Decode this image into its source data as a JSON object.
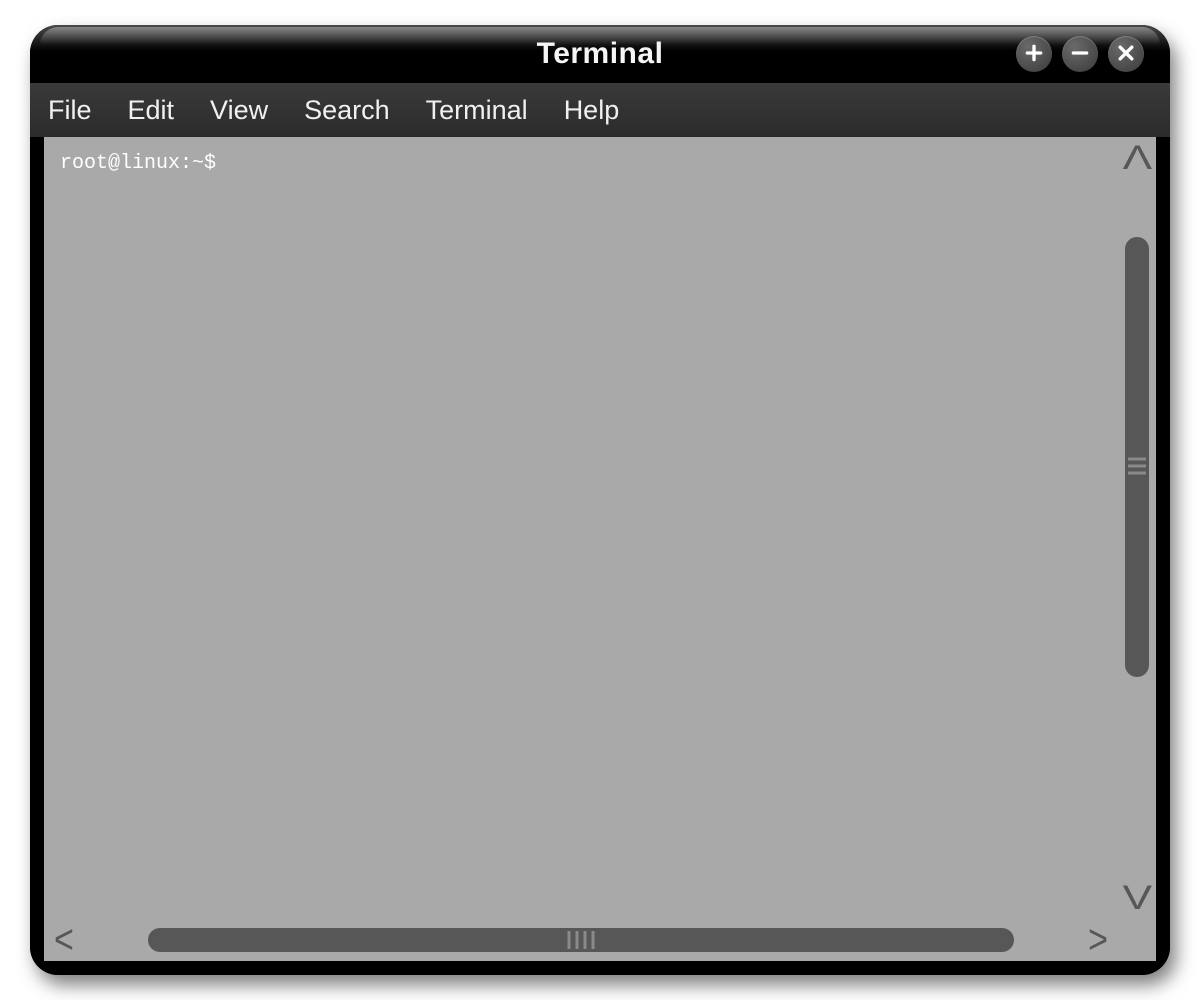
{
  "window": {
    "title": "Terminal"
  },
  "menu": {
    "items": [
      {
        "label": "File"
      },
      {
        "label": "Edit"
      },
      {
        "label": "View"
      },
      {
        "label": "Search"
      },
      {
        "label": "Terminal"
      },
      {
        "label": "Help"
      }
    ]
  },
  "terminal": {
    "prompt": "root@linux:~$"
  },
  "icons": {
    "plus": "plus-icon",
    "minus": "minus-icon",
    "close": "close-icon"
  }
}
